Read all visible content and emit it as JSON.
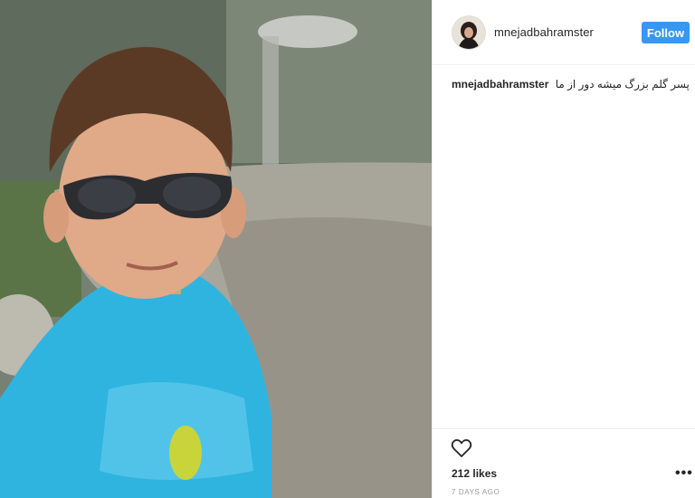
{
  "photo": {
    "alt_icon": "photo-child-sunglasses"
  },
  "header": {
    "username": "mnejadbahramster",
    "follow_label": "Follow"
  },
  "caption": {
    "username": "mnejadbahramster",
    "text": "پسر گلم بزرگ میشه دور از ما"
  },
  "footer": {
    "like_icon": "heart-icon",
    "likes": "212 likes",
    "time": "7 DAYS AGO",
    "more_icon": "more-options-icon"
  },
  "colors": {
    "accent": "#3897f0",
    "text": "#262626",
    "muted": "#999999"
  }
}
